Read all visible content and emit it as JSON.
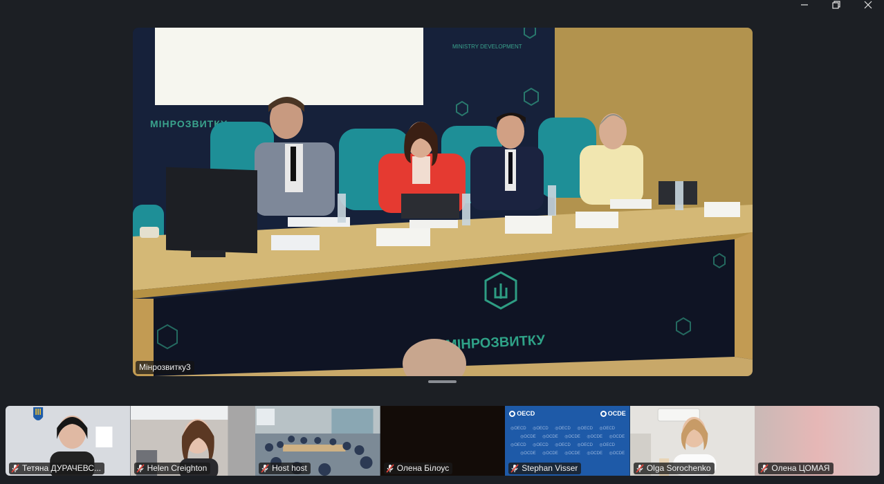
{
  "window": {
    "controls": [
      {
        "name": "minimize-button",
        "icon": "minimize-icon"
      },
      {
        "name": "restore-button",
        "icon": "restore-icon"
      },
      {
        "name": "close-button",
        "icon": "close-icon"
      }
    ]
  },
  "main_video": {
    "participant": "Мінрозвитку3",
    "backdrop_text": "МІНРОЗВИТКУ",
    "backdrop_text_upper": "MINISTRY DEVELOPMENT",
    "table_sign": "МІНРОЗВИТКУ"
  },
  "participants": [
    {
      "name": "Тетяна ДУРАЧЕВС...",
      "muted": true,
      "bg": "#d8dbe0"
    },
    {
      "name": "Helen Creighton",
      "muted": true,
      "bg": "#c9c4bf"
    },
    {
      "name": "Host host",
      "muted": true,
      "bg": "#7c8a96"
    },
    {
      "name": "Олена Білоус",
      "muted": true,
      "bg": "#0c0806"
    },
    {
      "name": "Stephan Visser",
      "muted": true,
      "bg": "#1e5aa8",
      "logo_left": "OECD",
      "logo_right": "OCDE"
    },
    {
      "name": "Olga Sorochenko",
      "muted": true,
      "bg": "#e5e3df"
    },
    {
      "name": "Олена ЦОМАЯ",
      "muted": true,
      "bg": "#e2b7b6"
    }
  ],
  "colors": {
    "app_bg": "#1c1f24",
    "mic_muted": "#e0463c",
    "label_bg": "#191919"
  }
}
